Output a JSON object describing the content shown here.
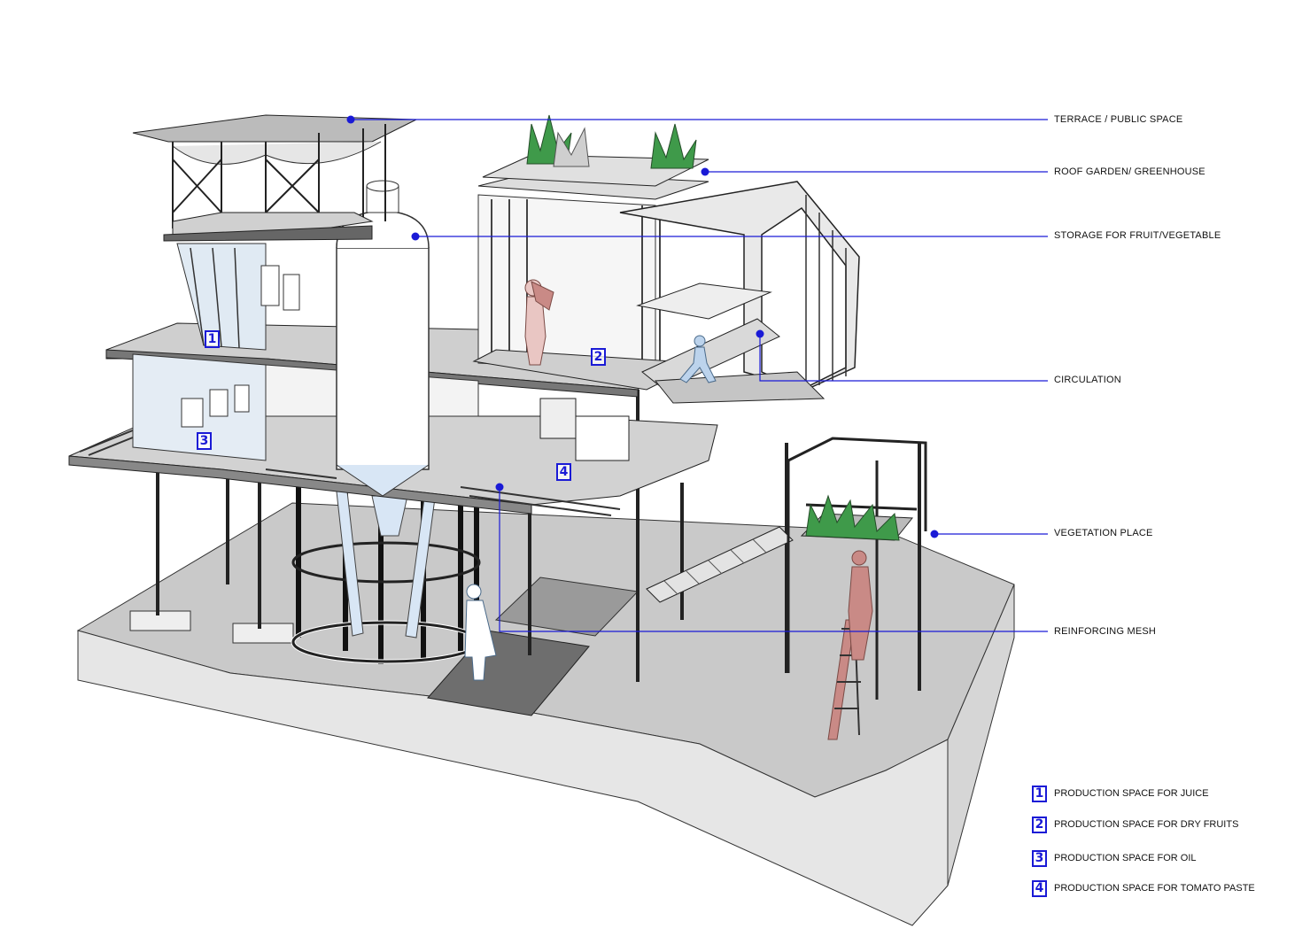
{
  "colors": {
    "accent": "#1a1ad6",
    "ground": "#c9c9c9",
    "ground_side": "#e9e9e9",
    "dark_pad": "#6e6e6e",
    "vegetation": "#3f9a4a",
    "figure_red": "#c98a86",
    "figure_blue": "#bcd3ec"
  },
  "callouts": [
    {
      "id": "terrace",
      "label": "TERRACE / PUBLIC SPACE"
    },
    {
      "id": "roof_garden",
      "label": "ROOF GARDEN/ GREENHOUSE"
    },
    {
      "id": "storage",
      "label": "STORAGE FOR FRUIT/VEGETABLE"
    },
    {
      "id": "circulation",
      "label": "CIRCULATION"
    },
    {
      "id": "vegetation",
      "label": "VEGETATION PLACE"
    },
    {
      "id": "mesh",
      "label": "REINFORCING MESH"
    }
  ],
  "zone_tags": [
    "1",
    "2",
    "3",
    "4"
  ],
  "legend": [
    {
      "num": "1",
      "label": "PRODUCTION SPACE FOR JUICE"
    },
    {
      "num": "2",
      "label": "PRODUCTION SPACE FOR DRY FRUITS"
    },
    {
      "num": "3",
      "label": "PRODUCTION SPACE FOR OIL"
    },
    {
      "num": "4",
      "label": "PRODUCTION SPACE FOR TOMATO PASTE"
    }
  ]
}
